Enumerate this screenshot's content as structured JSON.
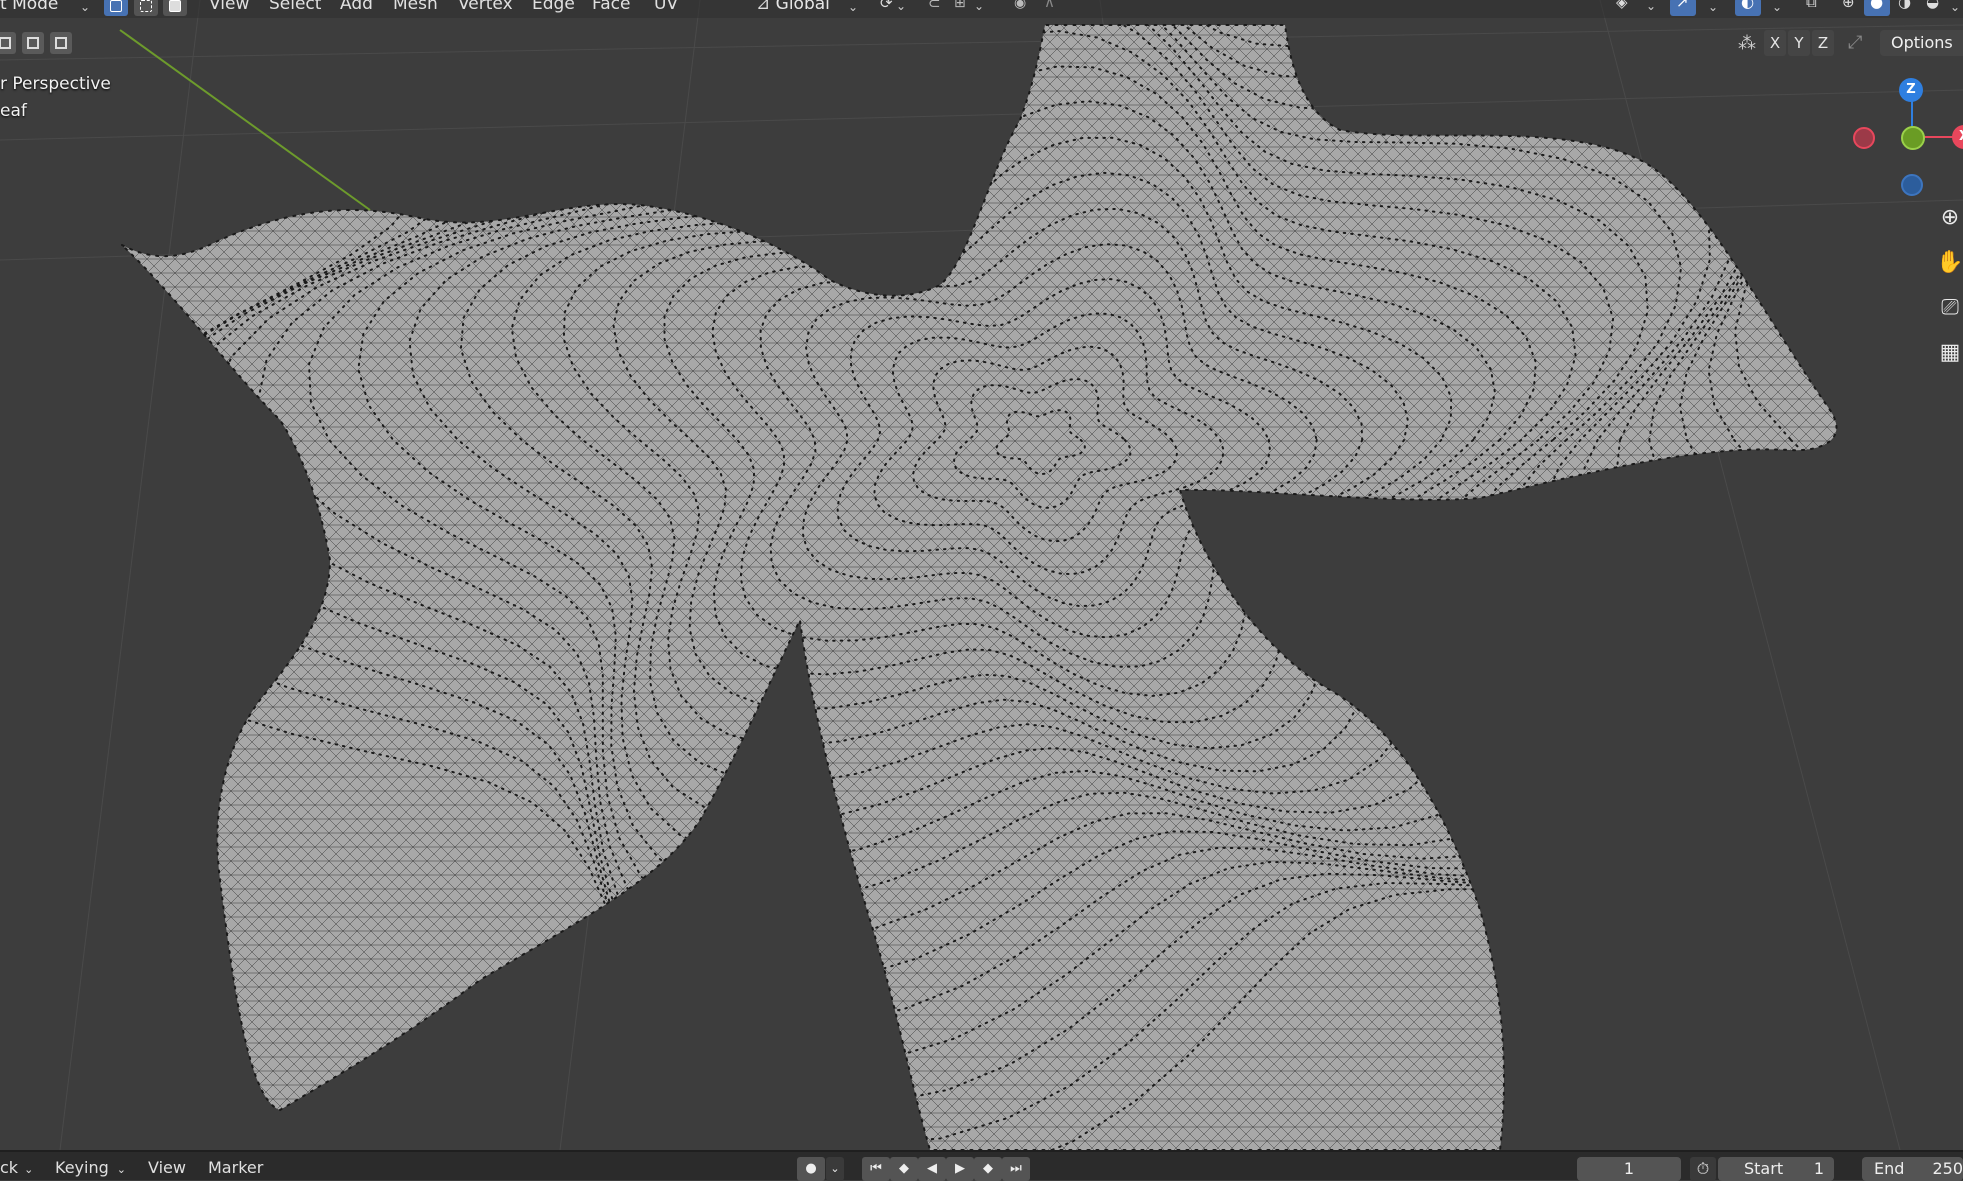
{
  "header": {
    "mode_label": "t Mode",
    "menus": [
      "View",
      "Select",
      "Add",
      "Mesh",
      "Vertex",
      "Edge",
      "Face",
      "UV"
    ],
    "transform_orientation": "Global"
  },
  "viewport": {
    "perspective_label": "r Perspective",
    "object_label": "eaf",
    "axis_buttons": [
      "X",
      "Y",
      "Z"
    ],
    "options_label": "Options",
    "gizmo": {
      "z_label": "Z",
      "x_label": "X"
    },
    "colors": {
      "background": "#3d3d3d",
      "mesh_face": "#a8a8a8",
      "mesh_edge": "#2a2a2a",
      "vertex": "#000000",
      "x_axis": "#e8475c",
      "y_axis": "#7ab02d",
      "z_axis": "#2f7fe0",
      "active_button": "#4772b3"
    },
    "nav_icons": [
      "zoom-icon",
      "hand-pan-icon",
      "camera-icon",
      "grid-view-icon"
    ]
  },
  "timeline": {
    "left_cut": "ck",
    "keying_label": "Keying",
    "view_label": "View",
    "marker_label": "Marker",
    "current_frame": "1",
    "start_label": "Start",
    "start_value": "1",
    "end_label": "End",
    "end_value": "250"
  }
}
